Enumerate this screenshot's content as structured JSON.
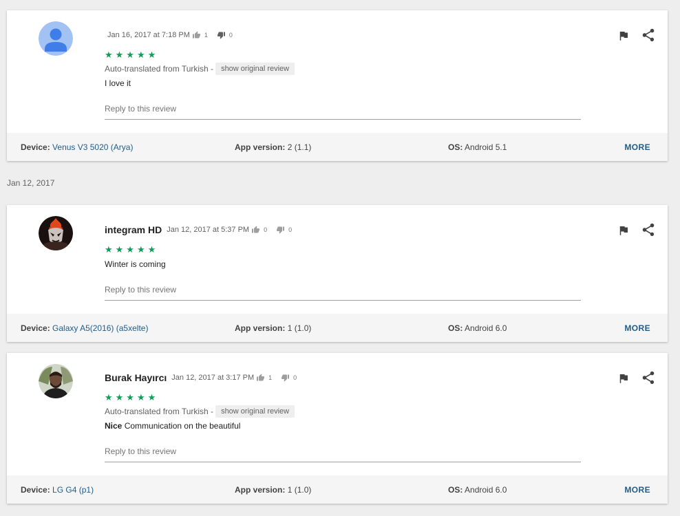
{
  "reviews": [
    {
      "author": "",
      "avatar": "default-person-icon",
      "date": "Jan 16, 2017 at 7:18 PM",
      "thumbs_up": "1",
      "thumbs_down": "0",
      "rating": "★★★★★",
      "translated_label": "Auto-translated from Turkish -",
      "show_original": "show original review",
      "text_bold": "",
      "text": "I love it",
      "reply_placeholder": "Reply to this review",
      "device_label": "Device:",
      "device": "Venus V3 5020 (Arya)",
      "app_version_label": "App version:",
      "app_version": "2 (1.1)",
      "os_label": "OS:",
      "os": "Android 5.1",
      "more": "MORE"
    },
    {
      "author": "integram HD",
      "avatar": "dark-mask-avatar",
      "date": "Jan 12, 2017 at 5:37 PM",
      "thumbs_up": "0",
      "thumbs_down": "0",
      "rating": "★★★★★",
      "text_bold": "",
      "text": "Winter is coming",
      "reply_placeholder": "Reply to this review",
      "device_label": "Device:",
      "device": "Galaxy A5(2016) (a5xelte)",
      "app_version_label": "App version:",
      "app_version": "1 (1.0)",
      "os_label": "OS:",
      "os": "Android 6.0",
      "more": "MORE"
    },
    {
      "author": "Burak Hayırcı",
      "avatar": "photo-avatar",
      "date": "Jan 12, 2017 at 3:17 PM",
      "thumbs_up": "1",
      "thumbs_down": "0",
      "rating": "★★★★★",
      "translated_label": "Auto-translated from Turkish -",
      "show_original": "show original review",
      "text_bold": "Nice",
      "text": " Communication on the beautiful",
      "reply_placeholder": "Reply to this review",
      "device_label": "Device:",
      "device": "LG G4 (p1)",
      "app_version_label": "App version:",
      "app_version": "1 (1.0)",
      "os_label": "OS:",
      "os": "Android 6.0",
      "more": "MORE"
    }
  ],
  "section_date": "Jan 12, 2017",
  "colors": {
    "star": "#0f9d58",
    "link": "#1f5c8c",
    "background": "#eeeeee"
  },
  "icons": [
    "thumb-up-icon",
    "thumb-down-icon",
    "flag-icon",
    "share-icon"
  ]
}
